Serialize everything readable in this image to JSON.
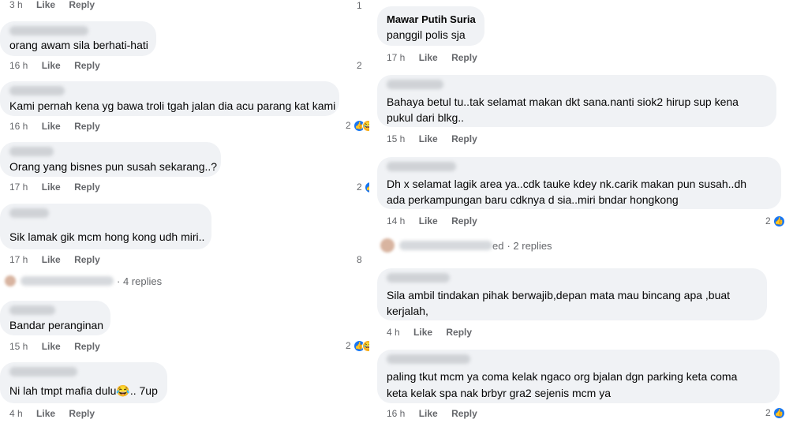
{
  "left": {
    "top_meta": {
      "time": "3 h",
      "like": "Like",
      "reply": "Reply",
      "reactions": "1"
    },
    "comments": [
      {
        "text": "orang awam sila berhati-hati",
        "time": "16 h",
        "like": "Like",
        "reply": "Reply",
        "reactions": "2"
      },
      {
        "text": "Kami pernah kena yg bawa troli tgah jalan dia acu parang kat kami",
        "time": "16 h",
        "like": "Like",
        "reply": "Reply",
        "reactions": "2"
      },
      {
        "text": "Orang yang bisnes pun susah sekarang..?",
        "time": "17 h",
        "like": "Like",
        "reply": "Reply",
        "reactions": "2"
      },
      {
        "text": "Sik lamak gik mcm hong kong udh miri..",
        "time": "17 h",
        "like": "Like",
        "reply": "Reply",
        "reactions": "8"
      },
      {
        "text": "Bandar peranginan",
        "time": "15 h",
        "like": "Like",
        "reply": "Reply",
        "reactions": "2"
      },
      {
        "text": "Ni lah tmpt mafia dulu😂.. 7up",
        "time": "4 h",
        "like": "Like",
        "reply": "Reply"
      }
    ],
    "replies_link": "· 4 replies"
  },
  "right": {
    "comments": [
      {
        "author": "Mawar Putih Suria",
        "text": "panggil polis sja",
        "time": "17 h",
        "like": "Like",
        "reply": "Reply"
      },
      {
        "text1": "Bahaya betul tu..tak selamat makan dkt sana.nanti siok2 hirup sup kena",
        "text2": "pukul dari blkg..",
        "time": "15 h",
        "like": "Like",
        "reply": "Reply"
      },
      {
        "text1": "Dh x selamat lagik area ya..cdk tauke kdey nk.carik makan pun susah..dh",
        "text2": "ada perkampungan baru cdknya d sia..miri bndar hongkong",
        "time": "14 h",
        "like": "Like",
        "reply": "Reply",
        "reactions": "2"
      },
      {
        "text1": "Sila ambil tindakan pihak berwajib,depan mata mau bincang apa ,buat",
        "text2": "kerjalah,",
        "time": "4 h",
        "like": "Like",
        "reply": "Reply"
      },
      {
        "text1": "paling tkut mcm ya coma kelak  ngaco org bjalan dgn parking keta coma",
        "text2": "keta kelak spa nak brbyr  gra2 sejenis mcm ya",
        "time": "16 h",
        "like": "Like",
        "reply": "Reply",
        "reactions": "2"
      }
    ],
    "replies_suffix": "ed",
    "replies_link": "· 2 replies"
  },
  "icons": {
    "like": "like-icon",
    "haha": "haha-icon"
  },
  "colors": {
    "bubble": "#f0f2f5",
    "like_blue": "#1877f2",
    "haha_yellow": "#f7b125",
    "meta_gray": "#65676b"
  }
}
